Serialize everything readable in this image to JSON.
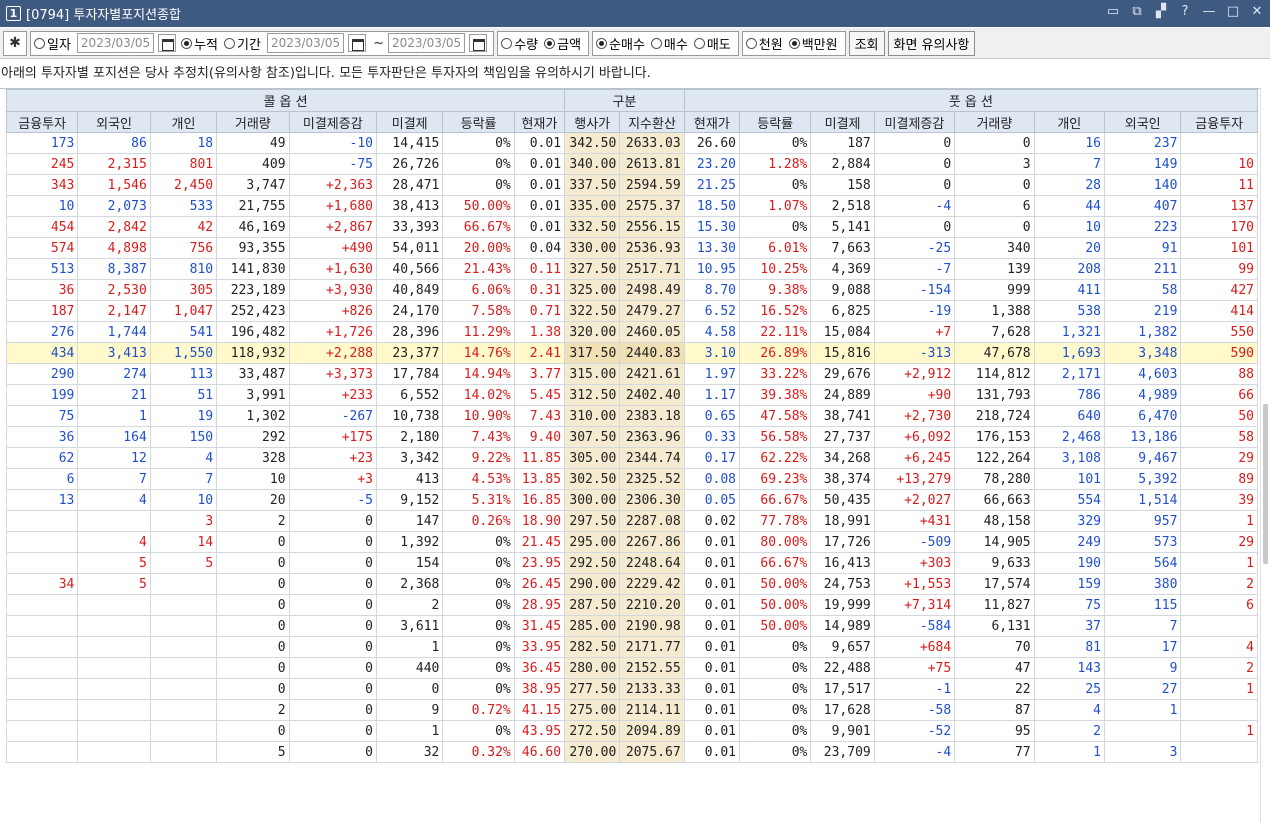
{
  "window": {
    "num": "1",
    "title": "[0794] 투자자별포지션종합",
    "controls": [
      "▭",
      "⧉",
      "▞",
      "?",
      "—",
      "□",
      "✕"
    ]
  },
  "toolbar": {
    "mode_options": [
      {
        "label": "일자",
        "selected": false
      },
      {
        "label": "누적",
        "selected": true
      },
      {
        "label": "기간",
        "selected": false
      }
    ],
    "date1": "2023/03/05",
    "date_from": "2023/03/05",
    "tilde": "~",
    "date_to": "2023/03/05",
    "unit_options": [
      {
        "label": "수량",
        "selected": false
      },
      {
        "label": "금액",
        "selected": true
      }
    ],
    "trade_options": [
      {
        "label": "순매수",
        "selected": true
      },
      {
        "label": "매수",
        "selected": false
      },
      {
        "label": "매도",
        "selected": false
      }
    ],
    "money_options": [
      {
        "label": "천원",
        "selected": false
      },
      {
        "label": "백만원",
        "selected": true
      }
    ],
    "query_button": "조회",
    "notice_button": "화면 유의사항"
  },
  "notice_text": "아래의 투자자별 포지션은 당사 추정치(유의사항 참조)입니다. 모든 투자판단은 투자자의 책임임을 유의하시기 바랍니다.",
  "table": {
    "group_headers": {
      "call": "콜 옵 션",
      "mid": "구분",
      "put": "풋 옵 션"
    },
    "columns": [
      "금융투자",
      "외국인",
      "개인",
      "거래량",
      "미결제증감",
      "미결제",
      "등락률",
      "현재가",
      "행사가",
      "지수환산",
      "현재가",
      "등락률",
      "미결제",
      "미결제증감",
      "거래량",
      "개인",
      "외국인",
      "금융투자"
    ],
    "highlight_row": 10,
    "rows": [
      [
        "173",
        "86",
        "18",
        "49",
        "-10",
        "14,415",
        "0%",
        "0.01",
        "342.50",
        "2633.03",
        "26.60",
        "0%",
        "187",
        "0",
        "0",
        "16",
        "237",
        ""
      ],
      [
        "245",
        "2,315",
        "801",
        "409",
        "-75",
        "26,726",
        "0%",
        "0.01",
        "340.00",
        "2613.81",
        "23.20",
        "1.28%",
        "2,884",
        "0",
        "3",
        "7",
        "149",
        "10"
      ],
      [
        "343",
        "1,546",
        "2,450",
        "3,747",
        "+2,363",
        "28,471",
        "0%",
        "0.01",
        "337.50",
        "2594.59",
        "21.25",
        "0%",
        "158",
        "0",
        "0",
        "28",
        "140",
        "11"
      ],
      [
        "10",
        "2,073",
        "533",
        "21,755",
        "+1,680",
        "38,413",
        "50.00%",
        "0.01",
        "335.00",
        "2575.37",
        "18.50",
        "1.07%",
        "2,518",
        "-4",
        "6",
        "44",
        "407",
        "137"
      ],
      [
        "454",
        "2,842",
        "42",
        "46,169",
        "+2,867",
        "33,393",
        "66.67%",
        "0.01",
        "332.50",
        "2556.15",
        "15.30",
        "0%",
        "5,141",
        "0",
        "0",
        "10",
        "223",
        "170"
      ],
      [
        "574",
        "4,898",
        "756",
        "93,355",
        "+490",
        "54,011",
        "20.00%",
        "0.04",
        "330.00",
        "2536.93",
        "13.30",
        "6.01%",
        "7,663",
        "-25",
        "340",
        "20",
        "91",
        "101"
      ],
      [
        "513",
        "8,387",
        "810",
        "141,830",
        "+1,630",
        "40,566",
        "21.43%",
        "0.11",
        "327.50",
        "2517.71",
        "10.95",
        "10.25%",
        "4,369",
        "-7",
        "139",
        "208",
        "211",
        "99"
      ],
      [
        "36",
        "2,530",
        "305",
        "223,189",
        "+3,930",
        "40,849",
        "6.06%",
        "0.31",
        "325.00",
        "2498.49",
        "8.70",
        "9.38%",
        "9,088",
        "-154",
        "999",
        "411",
        "58",
        "427"
      ],
      [
        "187",
        "2,147",
        "1,047",
        "252,423",
        "+826",
        "24,170",
        "7.58%",
        "0.71",
        "322.50",
        "2479.27",
        "6.52",
        "16.52%",
        "6,825",
        "-19",
        "1,388",
        "538",
        "219",
        "414"
      ],
      [
        "276",
        "1,744",
        "541",
        "196,482",
        "+1,726",
        "28,396",
        "11.29%",
        "1.38",
        "320.00",
        "2460.05",
        "4.58",
        "22.11%",
        "15,084",
        "+7",
        "7,628",
        "1,321",
        "1,382",
        "550"
      ],
      [
        "434",
        "3,413",
        "1,550",
        "118,932",
        "+2,288",
        "23,377",
        "14.76%",
        "2.41",
        "317.50",
        "2440.83",
        "3.10",
        "26.89%",
        "15,816",
        "-313",
        "47,678",
        "1,693",
        "3,348",
        "590"
      ],
      [
        "290",
        "274",
        "113",
        "33,487",
        "+3,373",
        "17,784",
        "14.94%",
        "3.77",
        "315.00",
        "2421.61",
        "1.97",
        "33.22%",
        "29,676",
        "+2,912",
        "114,812",
        "2,171",
        "4,603",
        "88"
      ],
      [
        "199",
        "21",
        "51",
        "3,991",
        "+233",
        "6,552",
        "14.02%",
        "5.45",
        "312.50",
        "2402.40",
        "1.17",
        "39.38%",
        "24,889",
        "+90",
        "131,793",
        "786",
        "4,989",
        "66"
      ],
      [
        "75",
        "1",
        "19",
        "1,302",
        "-267",
        "10,738",
        "10.90%",
        "7.43",
        "310.00",
        "2383.18",
        "0.65",
        "47.58%",
        "38,741",
        "+2,730",
        "218,724",
        "640",
        "6,470",
        "50"
      ],
      [
        "36",
        "164",
        "150",
        "292",
        "+175",
        "2,180",
        "7.43%",
        "9.40",
        "307.50",
        "2363.96",
        "0.33",
        "56.58%",
        "27,737",
        "+6,092",
        "176,153",
        "2,468",
        "13,186",
        "58"
      ],
      [
        "62",
        "12",
        "4",
        "328",
        "+23",
        "3,342",
        "9.22%",
        "11.85",
        "305.00",
        "2344.74",
        "0.17",
        "62.22%",
        "34,268",
        "+6,245",
        "122,264",
        "3,108",
        "9,467",
        "29"
      ],
      [
        "6",
        "7",
        "7",
        "10",
        "+3",
        "413",
        "4.53%",
        "13.85",
        "302.50",
        "2325.52",
        "0.08",
        "69.23%",
        "38,374",
        "+13,279",
        "78,280",
        "101",
        "5,392",
        "89"
      ],
      [
        "13",
        "4",
        "10",
        "20",
        "-5",
        "9,152",
        "5.31%",
        "16.85",
        "300.00",
        "2306.30",
        "0.05",
        "66.67%",
        "50,435",
        "+2,027",
        "66,663",
        "554",
        "1,514",
        "39"
      ],
      [
        "",
        "",
        "3",
        "2",
        "0",
        "147",
        "0.26%",
        "18.90",
        "297.50",
        "2287.08",
        "0.02",
        "77.78%",
        "18,991",
        "+431",
        "48,158",
        "329",
        "957",
        "1"
      ],
      [
        "",
        "4",
        "14",
        "0",
        "0",
        "1,392",
        "0%",
        "21.45",
        "295.00",
        "2267.86",
        "0.01",
        "80.00%",
        "17,726",
        "-509",
        "14,905",
        "249",
        "573",
        "29"
      ],
      [
        "",
        "5",
        "5",
        "0",
        "0",
        "154",
        "0%",
        "23.95",
        "292.50",
        "2248.64",
        "0.01",
        "66.67%",
        "16,413",
        "+303",
        "9,633",
        "190",
        "564",
        "1"
      ],
      [
        "34",
        "5",
        "",
        "0",
        "0",
        "2,368",
        "0%",
        "26.45",
        "290.00",
        "2229.42",
        "0.01",
        "50.00%",
        "24,753",
        "+1,553",
        "17,574",
        "159",
        "380",
        "2"
      ],
      [
        "",
        "",
        "",
        "0",
        "0",
        "2",
        "0%",
        "28.95",
        "287.50",
        "2210.20",
        "0.01",
        "50.00%",
        "19,999",
        "+7,314",
        "11,827",
        "75",
        "115",
        "6"
      ],
      [
        "",
        "",
        "",
        "0",
        "0",
        "3,611",
        "0%",
        "31.45",
        "285.00",
        "2190.98",
        "0.01",
        "50.00%",
        "14,989",
        "-584",
        "6,131",
        "37",
        "7",
        ""
      ],
      [
        "",
        "",
        "",
        "0",
        "0",
        "1",
        "0%",
        "33.95",
        "282.50",
        "2171.77",
        "0.01",
        "0%",
        "9,657",
        "+684",
        "70",
        "81",
        "17",
        "4"
      ],
      [
        "",
        "",
        "",
        "0",
        "0",
        "440",
        "0%",
        "36.45",
        "280.00",
        "2152.55",
        "0.01",
        "0%",
        "22,488",
        "+75",
        "47",
        "143",
        "9",
        "2"
      ],
      [
        "",
        "",
        "",
        "0",
        "0",
        "0",
        "0%",
        "38.95",
        "277.50",
        "2133.33",
        "0.01",
        "0%",
        "17,517",
        "-1",
        "22",
        "25",
        "27",
        "1"
      ],
      [
        "",
        "",
        "",
        "2",
        "0",
        "9",
        "0.72%",
        "41.15",
        "275.00",
        "2114.11",
        "0.01",
        "0%",
        "17,628",
        "-58",
        "87",
        "4",
        "1",
        ""
      ],
      [
        "",
        "",
        "",
        "0",
        "0",
        "1",
        "0%",
        "43.95",
        "272.50",
        "2094.89",
        "0.01",
        "0%",
        "9,901",
        "-52",
        "95",
        "2",
        "",
        "1"
      ],
      [
        "",
        "",
        "",
        "5",
        "0",
        "32",
        "0.32%",
        "46.60",
        "270.00",
        "2075.67",
        "0.01",
        "0%",
        "23,709",
        "-4",
        "77",
        "1",
        "3",
        ""
      ]
    ]
  }
}
